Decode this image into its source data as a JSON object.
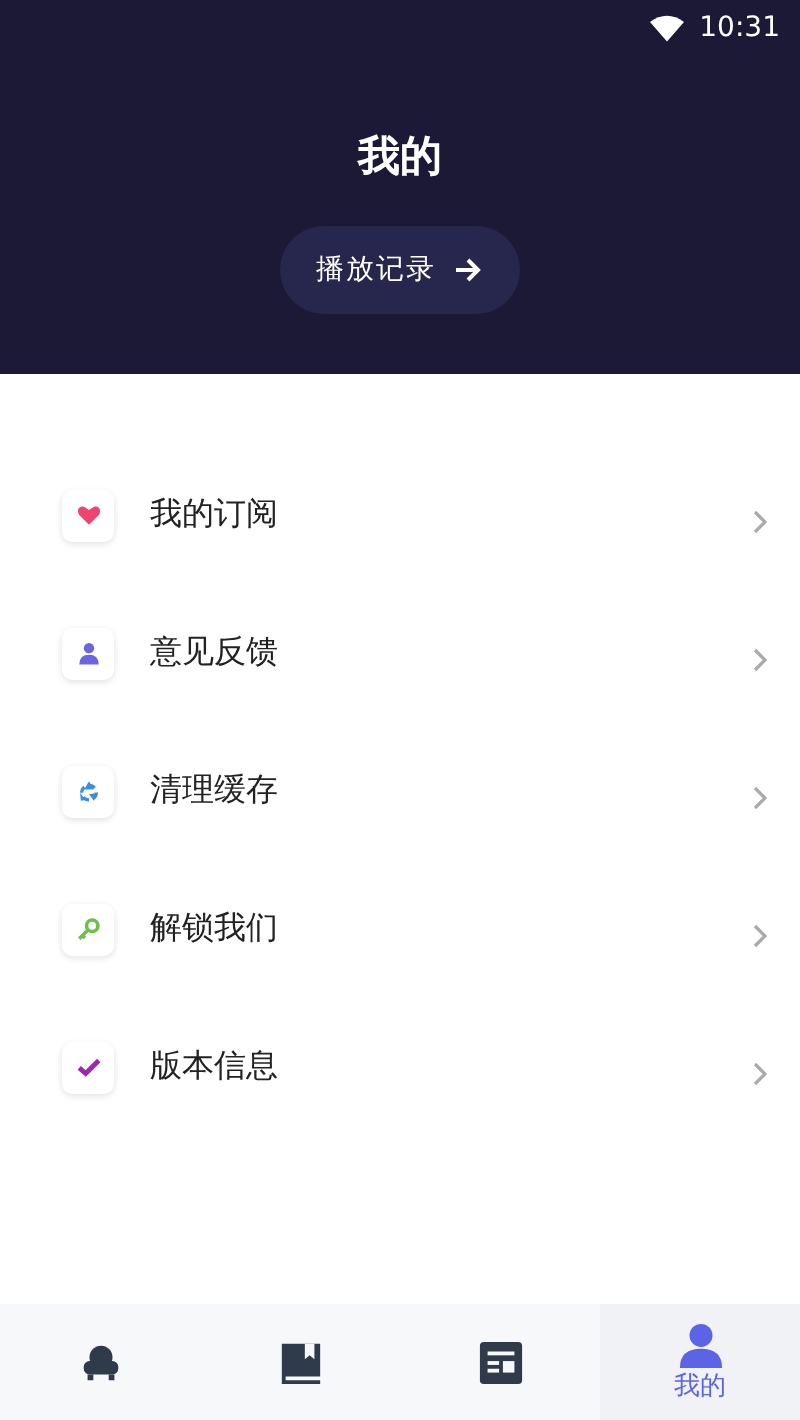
{
  "status_bar": {
    "time": "10:31"
  },
  "header": {
    "title": "我的",
    "history_button": "播放记录"
  },
  "menu": [
    {
      "label": "我的订阅",
      "kind": "heart"
    },
    {
      "label": "意见反馈",
      "kind": "person"
    },
    {
      "label": "清理缓存",
      "kind": "recycle"
    },
    {
      "label": "解锁我们",
      "kind": "key"
    },
    {
      "label": "版本信息",
      "kind": "check"
    }
  ],
  "tabs": [
    {
      "kind": "armchair",
      "selected": false
    },
    {
      "kind": "book",
      "selected": false
    },
    {
      "kind": "article",
      "selected": false
    },
    {
      "kind": "person",
      "label": "我的",
      "selected": true
    }
  ]
}
